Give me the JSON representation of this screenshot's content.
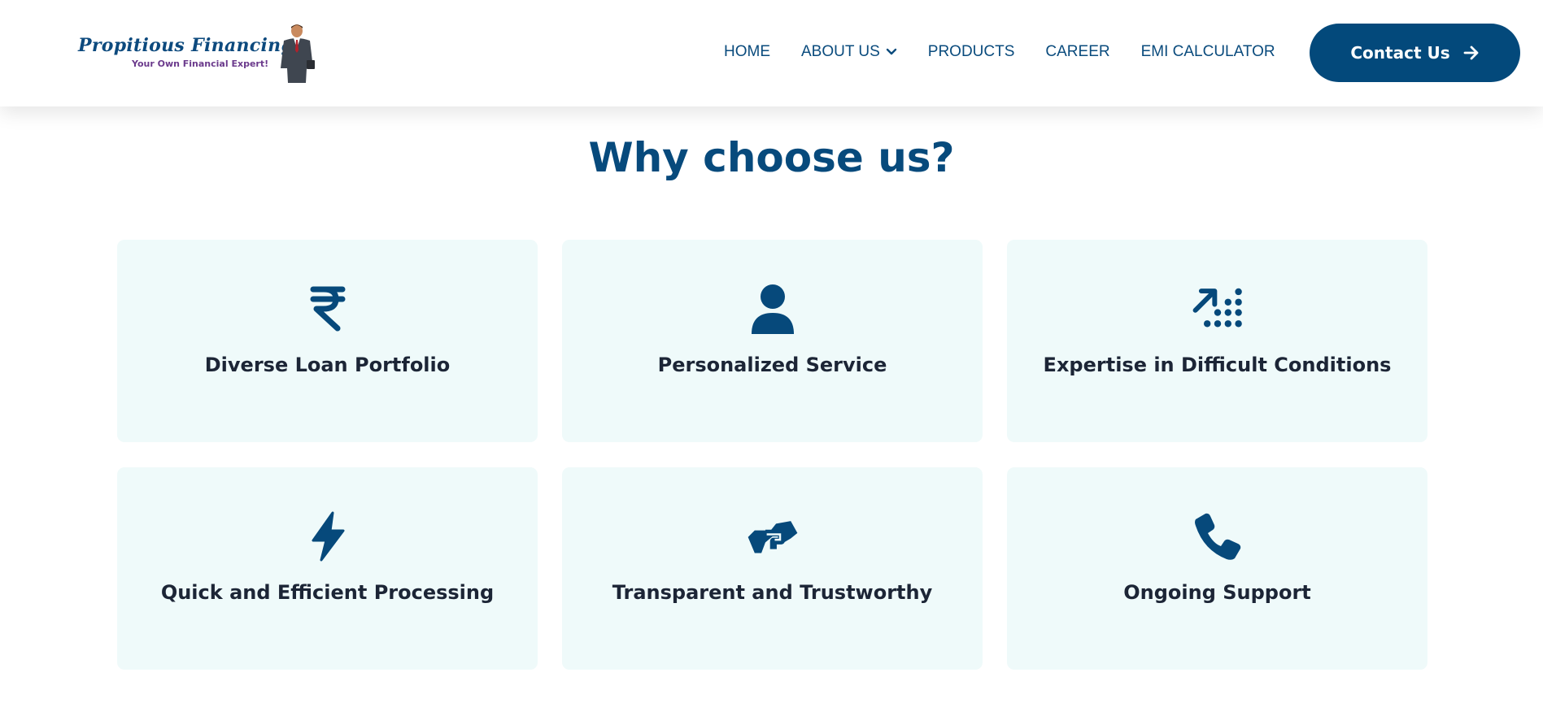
{
  "brand": {
    "name": "Propitious Financing",
    "tagline": "Your Own Financial Expert!"
  },
  "nav": {
    "items": [
      "HOME",
      "ABOUT US",
      "PRODUCTS",
      "CAREER",
      "EMI CALCULATOR"
    ],
    "contact_label": "Contact Us"
  },
  "section": {
    "title": "Why choose us?"
  },
  "features": [
    {
      "title": "Diverse Loan Portfolio",
      "icon": "rupee-icon"
    },
    {
      "title": "Personalized Service",
      "icon": "user-icon"
    },
    {
      "title": "Expertise in Difficult Conditions",
      "icon": "growth-arrow-icon"
    },
    {
      "title": "Quick and Efficient Processing",
      "icon": "lightning-icon"
    },
    {
      "title": "Transparent and Trustworthy",
      "icon": "handshake-icon"
    },
    {
      "title": "Ongoing Support",
      "icon": "phone-icon"
    }
  ],
  "colors": {
    "primary": "#03497b",
    "card_background": "#effafa",
    "heading": "#074a7c",
    "text": "#1c2536"
  }
}
